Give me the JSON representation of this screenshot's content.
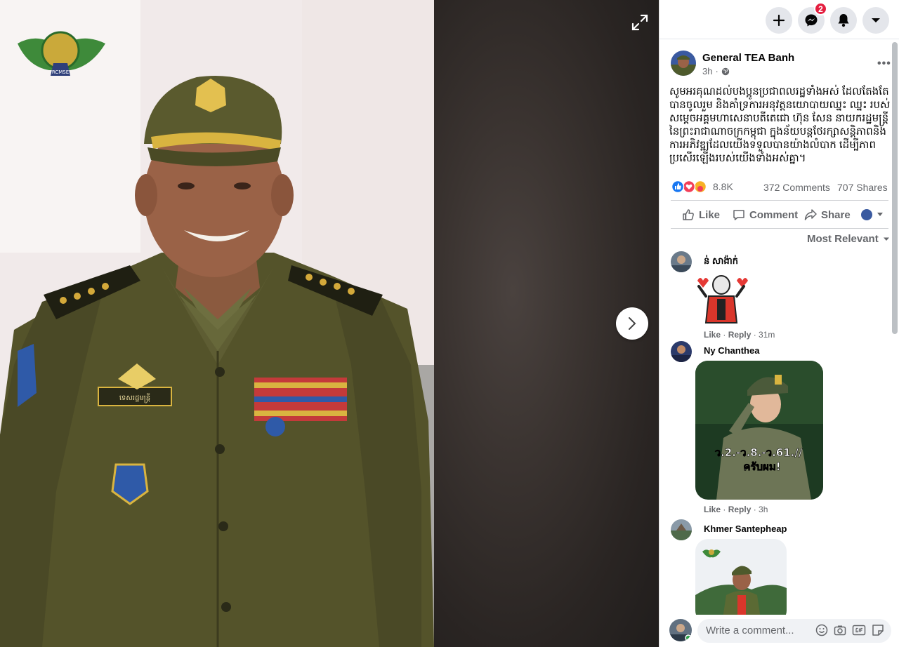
{
  "viewer": {
    "photo_logo_caption": "RCMSE",
    "badge_name_text": "ទេសរដ្ឋមន្ត្រី"
  },
  "topbar": {
    "messenger_badge": "2"
  },
  "post": {
    "author": "General TEA Banh",
    "time": "3h",
    "text": "សូមអរគុណដល់បងប្អូនប្រជាពលរដ្ឋទាំងអស់ ដែលតែងតែបានចូលរួម និងគាំទ្រការអនុវត្តនយោបាយឈ្នះ ឈ្នះ របស់សម្តេចអគ្គមហាសេនាបតីតេជោ ហ៊ុន សែន នាយករដ្ឋមន្ត្រីនៃព្រះរាជាណាចក្រកម្ពុជា ក្នុងន័យបន្តថែរក្សាសន្តិភាពនិងការអភិវឌ្ឍដែលយើងទទួលបានយ៉ាងលំបាក ដើម្បីភាពប្រសើរឡើងរបស់យើងទាំងអស់គ្នា។",
    "reactions_count": "8.8K",
    "comments_count": "372 Comments",
    "shares_count": "707 Shares"
  },
  "actions": {
    "like": "Like",
    "comment": "Comment",
    "share": "Share"
  },
  "sort_label": "Most Relevant",
  "comments": [
    {
      "name": "ន់ សាង៉ាក់",
      "like": "Like",
      "reply": "Reply",
      "time": "31m"
    },
    {
      "name": "Ny Chanthea",
      "like": "Like",
      "reply": "Reply",
      "time": "3h",
      "image_text_line1": "ว.2.-ว.8.-ว.61.//",
      "image_text_line2": "ครับผม!"
    },
    {
      "name": "Khmer Santepheap"
    }
  ],
  "composer": {
    "placeholder": "Write a comment..."
  },
  "colors": {
    "accent_blue": "#1877f2",
    "badge_red": "#e41e3f",
    "muted_text": "#65676b"
  },
  "icons": [
    "expand-icon",
    "next-arrow-icon",
    "plus-icon",
    "messenger-icon",
    "bell-icon",
    "caret-down-icon",
    "globe-icon",
    "like-reaction-icon",
    "love-reaction-icon",
    "care-reaction-icon",
    "thumbs-up-icon",
    "comment-icon",
    "share-icon",
    "emoji-icon",
    "camera-icon",
    "gif-icon",
    "sticker-icon"
  ]
}
